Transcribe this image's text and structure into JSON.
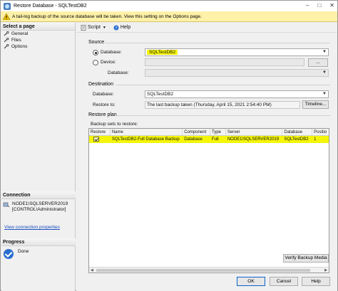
{
  "window": {
    "title": "Restore Database - SQLTestDB2"
  },
  "banner": {
    "text": "A tail-log backup of the source database will be taken. View this setting on the Options page."
  },
  "left": {
    "select_page_header": "Select a page",
    "pages": [
      {
        "label": "General",
        "icon": "wrench-icon"
      },
      {
        "label": "Files",
        "icon": "wrench-icon"
      },
      {
        "label": "Options",
        "icon": "wrench-icon"
      }
    ],
    "connection_header": "Connection",
    "connection_line1": "NODE1\\SQLSERVER2019",
    "connection_line2": "[CONTROL\\Administrator]",
    "view_connection_link": "View connection properties",
    "progress_header": "Progress",
    "progress_status": "Done"
  },
  "toolbar": {
    "script_label": "Script",
    "help_label": "Help"
  },
  "source": {
    "group_label": "Source",
    "database_radio_label": "Database:",
    "database_value": "SQLTestDB2",
    "device_radio_label": "Device:",
    "device_value": "",
    "database_sub_label": "Database:",
    "database_sub_value": ""
  },
  "destination": {
    "group_label": "Destination",
    "database_label": "Database:",
    "database_value": "SQLTestDB2",
    "restore_to_label": "Restore to:",
    "restore_to_value": "The last backup taken (Thursday, April 15, 2021 2:54:40 PM)",
    "timeline_button": "Timeline..."
  },
  "restore_plan": {
    "group_label": "Restore plan",
    "backup_sets_label": "Backup sets to restore:",
    "columns": [
      "Restore",
      "Name",
      "Component",
      "Type",
      "Server",
      "Database",
      "Positio"
    ],
    "rows": [
      {
        "restore": true,
        "name": "SQLTestDB2-Full Database Backup",
        "component": "Database",
        "type": "Full",
        "server": "NODE1\\SQLSERVER2019",
        "database": "SQLTestDB2",
        "position": "1"
      }
    ],
    "verify_button": "Verify Backup Media"
  },
  "footer": {
    "ok": "OK",
    "cancel": "Cancel",
    "help": "Help"
  },
  "colors": {
    "highlight": "#f5f50a",
    "banner": "#fff1a8",
    "link": "#1a4fbf"
  }
}
